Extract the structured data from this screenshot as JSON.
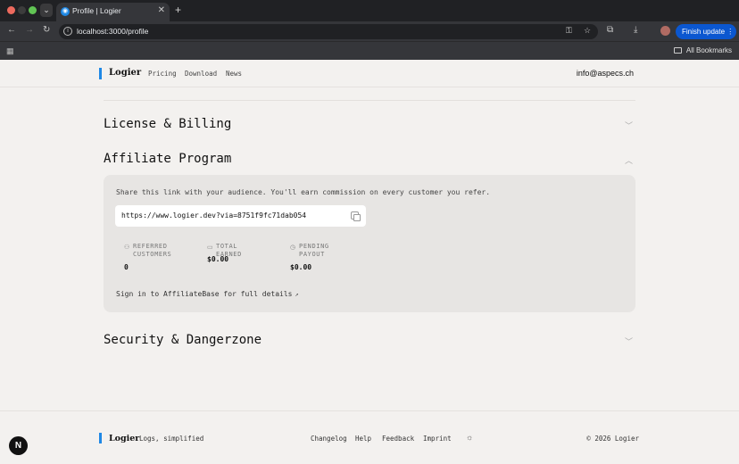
{
  "browser": {
    "tab_title": "Profile | Logier",
    "url": "localhost:3000/profile",
    "finish_update_label": "Finish update",
    "all_bookmarks_label": "All Bookmarks"
  },
  "header": {
    "logo": "Logier",
    "nav": [
      "Pricing",
      "Download",
      "News"
    ],
    "email": "info@aspecs.ch"
  },
  "sections": {
    "license_title": "License & Billing",
    "affiliate_title": "Affiliate Program",
    "security_title": "Security & Dangerzone"
  },
  "affiliate": {
    "description": "Share this link with your audience. You'll earn commission on every customer you refer.",
    "link": "https://www.logier.dev?via=8751f9fc71dab054",
    "stats": [
      {
        "label_line1": "REFERRED",
        "label_line2": "CUSTOMERS",
        "value": "0",
        "icon": "users-icon"
      },
      {
        "label_line1": "TOTAL EARNED",
        "label_line2": "",
        "value": "$0.00",
        "icon": "wallet-icon"
      },
      {
        "label_line1": "PENDING",
        "label_line2": "PAYOUT",
        "value": "$0.00",
        "icon": "clock-icon"
      }
    ],
    "signin_text": "Sign in to AffiliateBase for full details"
  },
  "footer": {
    "logo": "Logier",
    "tagline": "Logs, simplified",
    "links": [
      "Changelog",
      "Help",
      "Feedback",
      "Imprint"
    ],
    "copyright": "© 2026 Logier"
  },
  "dev_badge": "N"
}
